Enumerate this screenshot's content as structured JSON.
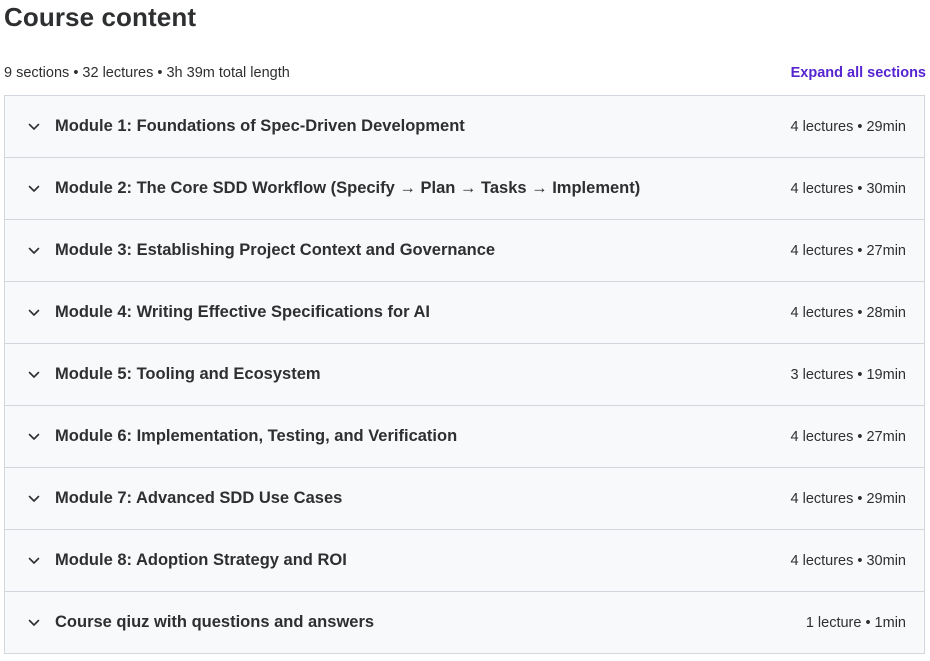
{
  "header": {
    "title": "Course content"
  },
  "summary": {
    "text": "9 sections • 32 lectures • 3h 39m total length",
    "expand_label": "Expand all sections"
  },
  "colors": {
    "accent": "#5624d0",
    "text": "#2d2f31",
    "section_bg": "#f7f9fa",
    "border": "#d1d7dc"
  },
  "icons": {
    "section_toggle": "chevron-down-icon"
  },
  "sections": [
    {
      "title": "Module 1: Foundations of Spec-Driven Development",
      "meta": "4 lectures • 29min"
    },
    {
      "title": "Module 2: The Core SDD Workflow (Specify → Plan → Tasks → Implement)",
      "meta": "4 lectures • 30min"
    },
    {
      "title": "Module 3: Establishing Project Context and Governance",
      "meta": "4 lectures • 27min"
    },
    {
      "title": "Module 4: Writing Effective Specifications for AI",
      "meta": "4 lectures • 28min"
    },
    {
      "title": "Module 5: Tooling and Ecosystem",
      "meta": "3 lectures • 19min"
    },
    {
      "title": "Module 6: Implementation, Testing, and Verification",
      "meta": "4 lectures • 27min"
    },
    {
      "title": "Module 7: Advanced SDD Use Cases",
      "meta": "4 lectures • 29min"
    },
    {
      "title": "Module 8: Adoption Strategy and ROI",
      "meta": "4 lectures • 30min"
    },
    {
      "title": "Course qiuz with questions and answers",
      "meta": "1 lecture • 1min"
    }
  ]
}
